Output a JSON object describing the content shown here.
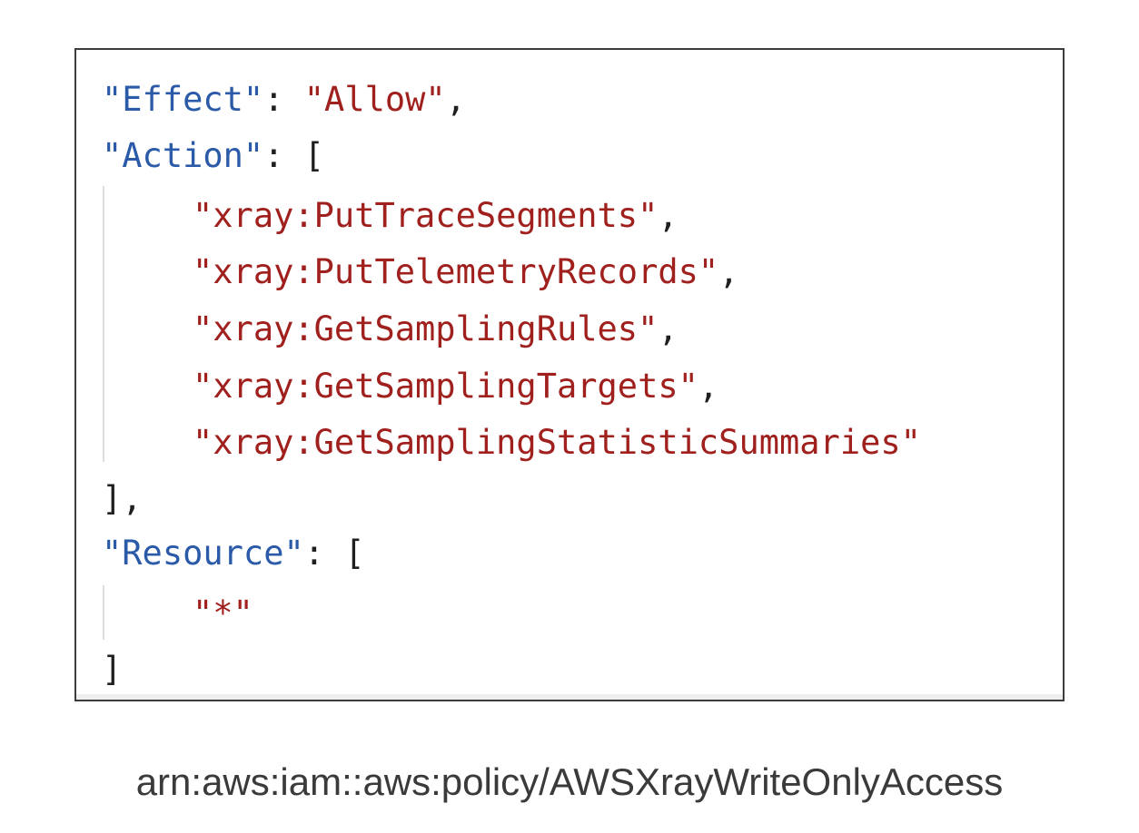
{
  "policy_document": {
    "effect_key": "\"Effect\"",
    "effect_value": "\"Allow\"",
    "action_key": "\"Action\"",
    "actions": [
      "\"xray:PutTraceSegments\"",
      "\"xray:PutTelemetryRecords\"",
      "\"xray:GetSamplingRules\"",
      "\"xray:GetSamplingTargets\"",
      "\"xray:GetSamplingStatisticSummaries\""
    ],
    "resource_key": "\"Resource\"",
    "resources": [
      "\"*\""
    ],
    "punctuation": {
      "colon": ": ",
      "comma": ",",
      "open_bracket": "[",
      "close_bracket_comma": "],",
      "close_bracket": "]"
    }
  },
  "caption": "arn:aws:iam::aws:policy/AWSXrayWriteOnlyAccess",
  "colors": {
    "key": "#2a5aa8",
    "string": "#a0201e",
    "punctuation": "#1f1f1f",
    "caption": "#3a3a3a",
    "border": "#3c3c3c"
  }
}
